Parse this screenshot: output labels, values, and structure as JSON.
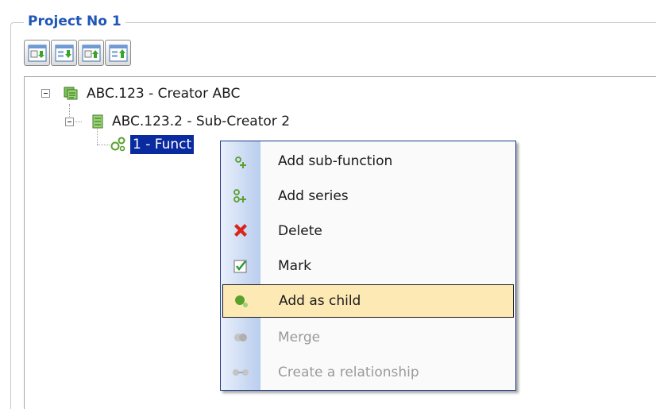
{
  "group": {
    "title": "Project No 1"
  },
  "toolbar": {
    "buttons": [
      {
        "icon": "expand-down-icon"
      },
      {
        "icon": "expand-all-icon"
      },
      {
        "icon": "collapse-up-icon"
      },
      {
        "icon": "collapse-all-icon"
      }
    ]
  },
  "tree": {
    "root": {
      "label": "ABC.123 - Creator ABC",
      "icon": "creator-icon"
    },
    "child": {
      "label": "ABC.123.2 - Sub-Creator 2",
      "icon": "sub-creator-icon"
    },
    "leaf": {
      "label": "1 - Funct",
      "icon": "function-gears-icon"
    }
  },
  "context_menu": {
    "items": [
      {
        "label": "Add sub-function",
        "icon": "add-sub-function-icon",
        "enabled": true
      },
      {
        "label": "Add series",
        "icon": "add-series-icon",
        "enabled": true
      },
      {
        "label": "Delete",
        "icon": "delete-x-icon",
        "enabled": true
      },
      {
        "label": "Mark",
        "icon": "checkbox-checked-icon",
        "enabled": true
      },
      {
        "label": "Add as child",
        "icon": "add-as-child-icon",
        "enabled": true,
        "highlighted": true
      },
      {
        "label": "Merge",
        "icon": "merge-icon",
        "enabled": false
      },
      {
        "label": "Create a relationship",
        "icon": "relationship-icon",
        "enabled": false
      }
    ]
  },
  "colors": {
    "title": "#1f56b8",
    "selection": "#0a2aa0",
    "menu_highlight": "#fde9b4",
    "menu_border": "#1e3e8a",
    "delete_red": "#d9251c",
    "green_icon": "#5aa02c"
  }
}
